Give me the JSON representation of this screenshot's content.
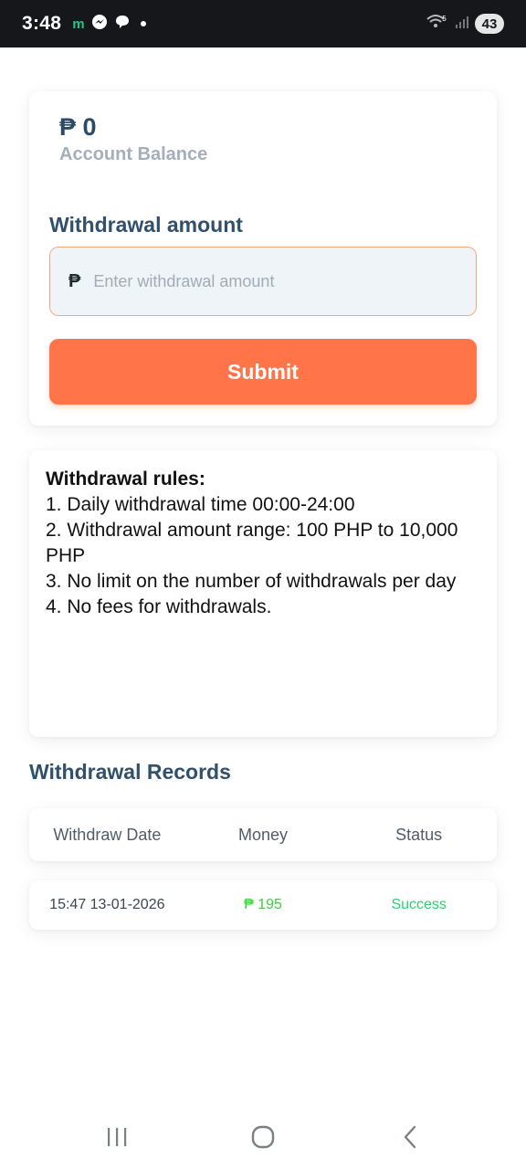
{
  "status_bar": {
    "time": "3:48",
    "notification_m": "m",
    "network_label": "5",
    "battery": "43"
  },
  "balance": {
    "currency_symbol": "₱",
    "amount": "0",
    "label": "Account Balance"
  },
  "withdraw": {
    "title": "Withdrawal amount",
    "currency_symbol": "₱",
    "placeholder": "Enter withdrawal amount",
    "value": "",
    "submit_label": "Submit"
  },
  "rules": {
    "title": "Withdrawal rules:",
    "lines": [
      "1. Daily withdrawal time 00:00-24:00",
      "2. Withdrawal amount range: 100 PHP to 10,000 PHP",
      "3. No limit on the number of withdrawals per day",
      "4. No fees for withdrawals."
    ]
  },
  "records": {
    "title": "Withdrawal Records",
    "columns": [
      "Withdraw Date",
      "Money",
      "Status"
    ],
    "rows": [
      {
        "date": "15:47 13-01-2026",
        "money": "₱ 195",
        "status": "Success"
      }
    ]
  },
  "colors": {
    "accent": "#ff7549",
    "heading": "#30506b",
    "success": "#2fcf70",
    "money": "#3fcc42"
  },
  "icons": {
    "nav_recents": "recent-apps-icon",
    "nav_home": "home-icon",
    "nav_back": "back-icon"
  }
}
